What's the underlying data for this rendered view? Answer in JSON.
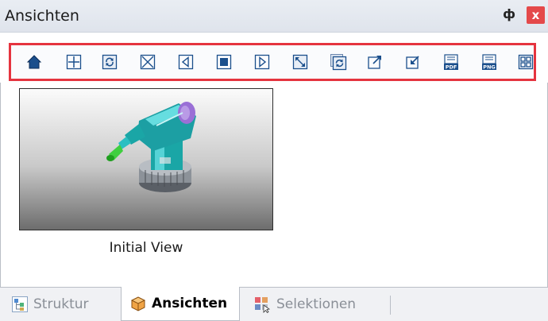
{
  "window": {
    "title": "Ansichten",
    "pin_glyph": "ф",
    "close_glyph": "x"
  },
  "toolbar": {
    "buttons": [
      {
        "name": "home-view-button",
        "icon": "home-icon"
      },
      {
        "name": "add-view-button",
        "icon": "plus-icon"
      },
      {
        "name": "refresh-view-button",
        "icon": "refresh-icon"
      },
      {
        "name": "delete-view-button",
        "icon": "delete-x-icon"
      },
      {
        "name": "previous-view-button",
        "icon": "previous-icon"
      },
      {
        "name": "stop-button",
        "icon": "stop-icon"
      },
      {
        "name": "next-view-button",
        "icon": "next-icon"
      },
      {
        "name": "fit-view-button",
        "icon": "fit-arrows-icon"
      },
      {
        "name": "update-all-views-button",
        "icon": "refresh-all-icon"
      },
      {
        "name": "export-view-button",
        "icon": "export-icon"
      },
      {
        "name": "import-view-button",
        "icon": "import-icon"
      },
      {
        "name": "export-pdf-button",
        "icon": "pdf-icon",
        "text": "PDF"
      },
      {
        "name": "export-png-button",
        "icon": "png-icon",
        "text": "PNG"
      },
      {
        "name": "grid-layout-button",
        "icon": "grid-icon"
      }
    ]
  },
  "views": [
    {
      "label": "Initial View"
    }
  ],
  "tabs": [
    {
      "label": "Struktur",
      "icon": "structure-icon",
      "active": false
    },
    {
      "label": "Ansichten",
      "icon": "views-cube-icon",
      "active": true
    },
    {
      "label": "Selektionen",
      "icon": "selections-icon",
      "active": false
    }
  ],
  "colors": {
    "highlight_border": "#e5343f",
    "close_button": "#e4494a",
    "icon_blue": "#1b4f8c"
  }
}
